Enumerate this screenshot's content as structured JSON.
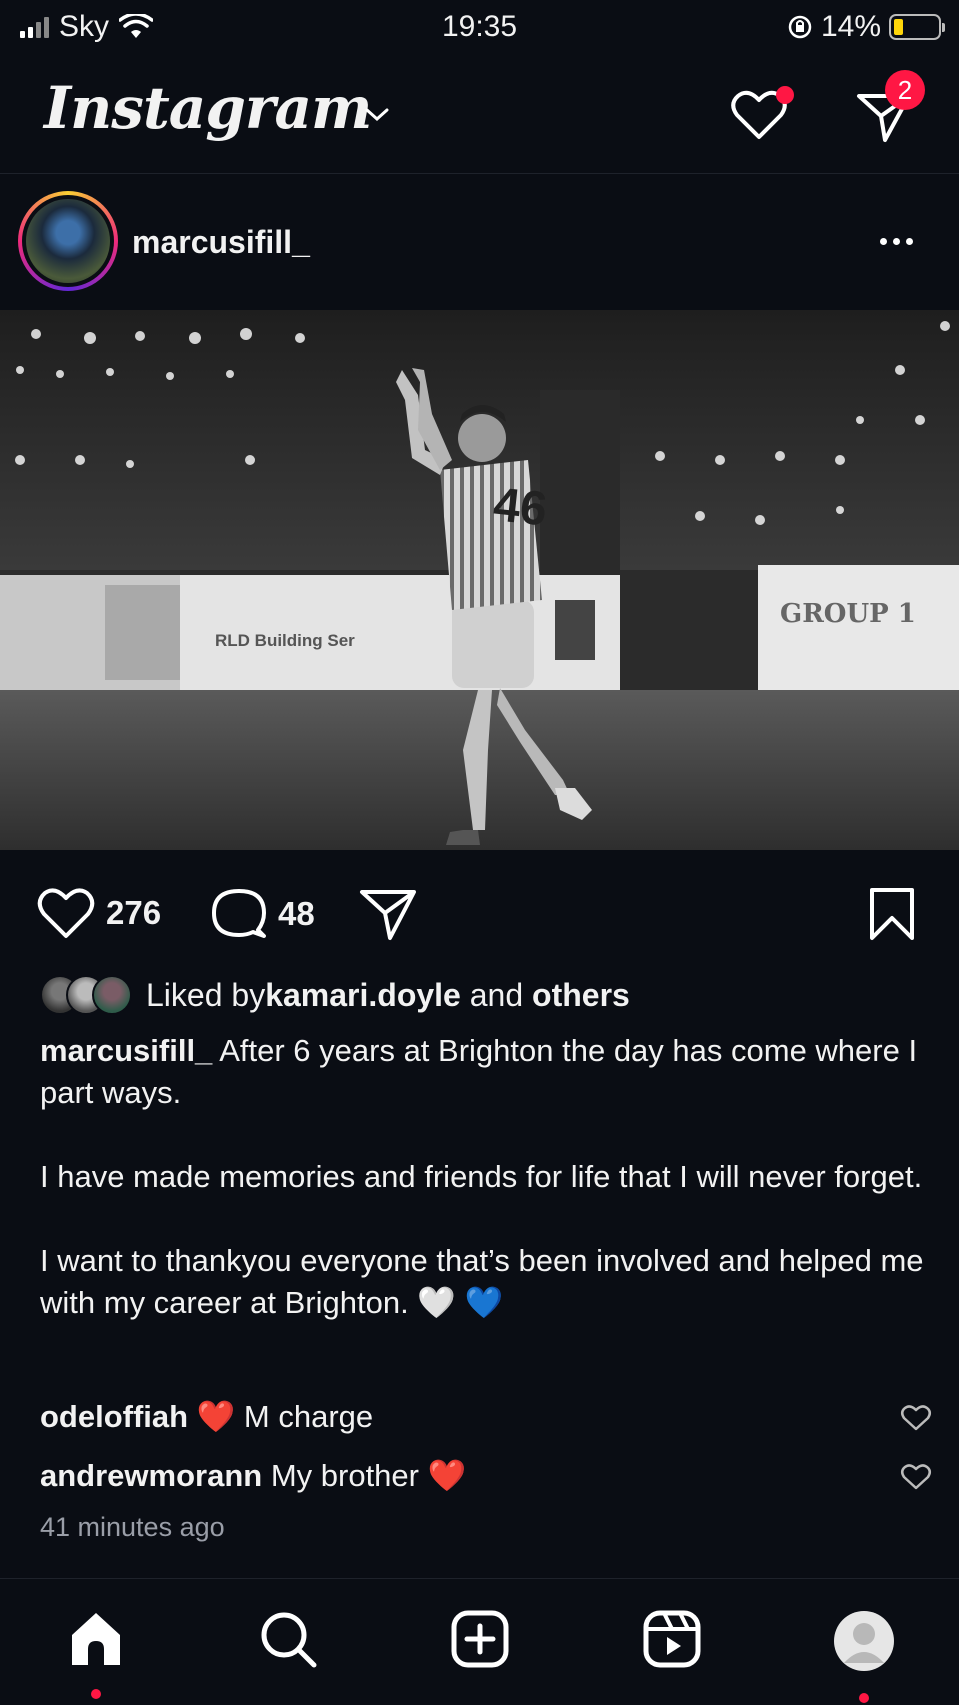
{
  "status_bar": {
    "carrier": "Sky",
    "time": "19:35",
    "battery": "14%"
  },
  "header": {
    "logo": "Instagram",
    "dm_badge": "2"
  },
  "post": {
    "username": "marcusifill_",
    "photo_banners": {
      "left": "RLD Building Ser",
      "right": "GROUP 1"
    },
    "like_count": "276",
    "comment_count": "48",
    "likes": {
      "prefix": "Liked by ",
      "user": "kamari.doyle",
      "mid": " and ",
      "others": "others"
    },
    "caption": {
      "username": "marcusifill_",
      "p1": " After 6 years at Brighton the day has come where I part ways.",
      "p2": "I have made memories and friends for life that I will never forget.",
      "p3": "I want to thankyou everyone that’s been involved and helped me with my career at Brighton. 🤍 💙"
    },
    "comments": [
      {
        "user": "odeloffiah",
        "text": " ❤️ M charge"
      },
      {
        "user": "andrewmorann",
        "text": " My brother ❤️"
      }
    ],
    "time_ago": "41 minutes ago"
  }
}
